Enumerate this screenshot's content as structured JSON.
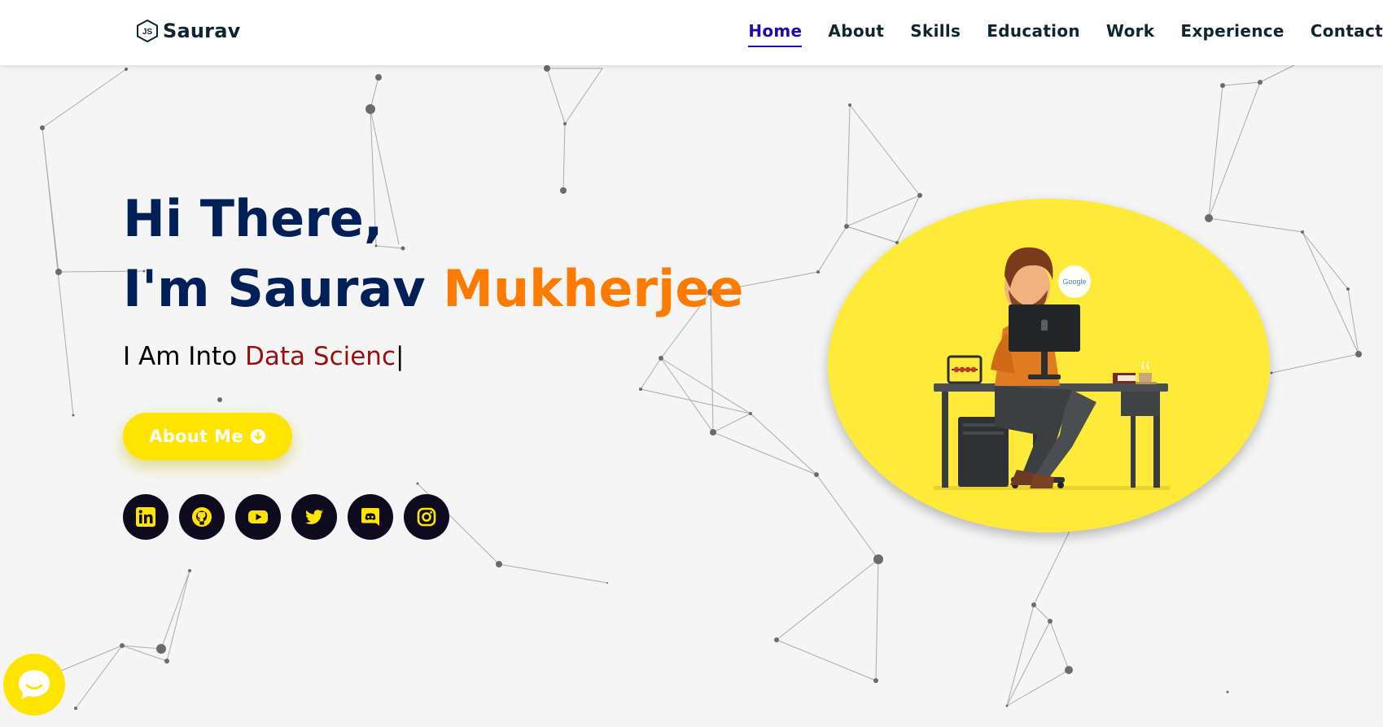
{
  "brand": {
    "logo_text": "JS",
    "name": "Saurav"
  },
  "nav": {
    "items": [
      {
        "label": "Home",
        "active": true
      },
      {
        "label": "About",
        "active": false
      },
      {
        "label": "Skills",
        "active": false
      },
      {
        "label": "Education",
        "active": false
      },
      {
        "label": "Work",
        "active": false
      },
      {
        "label": "Experience",
        "active": false
      },
      {
        "label": "Contact",
        "active": false
      }
    ]
  },
  "hero": {
    "greeting": "Hi There,",
    "intro": "I'm Saurav ",
    "surname": "Mukherjee",
    "typed_prefix": "I Am Into ",
    "typed_value": "Data Scienc",
    "typed_cursor": "|",
    "button_label": "About Me",
    "button_icon": "arrow-circle-down-icon"
  },
  "socials": [
    "linkedin-icon",
    "github-icon",
    "youtube-icon",
    "twitter-icon",
    "discord-icon",
    "instagram-icon"
  ],
  "illustration": {
    "bubble_text": "Google"
  },
  "chat_widget": {
    "icon": "chat-bubble-icon"
  },
  "colors": {
    "navy": "#002057",
    "orange": "#ff7b00",
    "dark_red": "#991010",
    "yellow": "#ffe400",
    "active_nav": "#2506ad",
    "social_bg": "#0e0b1f"
  }
}
